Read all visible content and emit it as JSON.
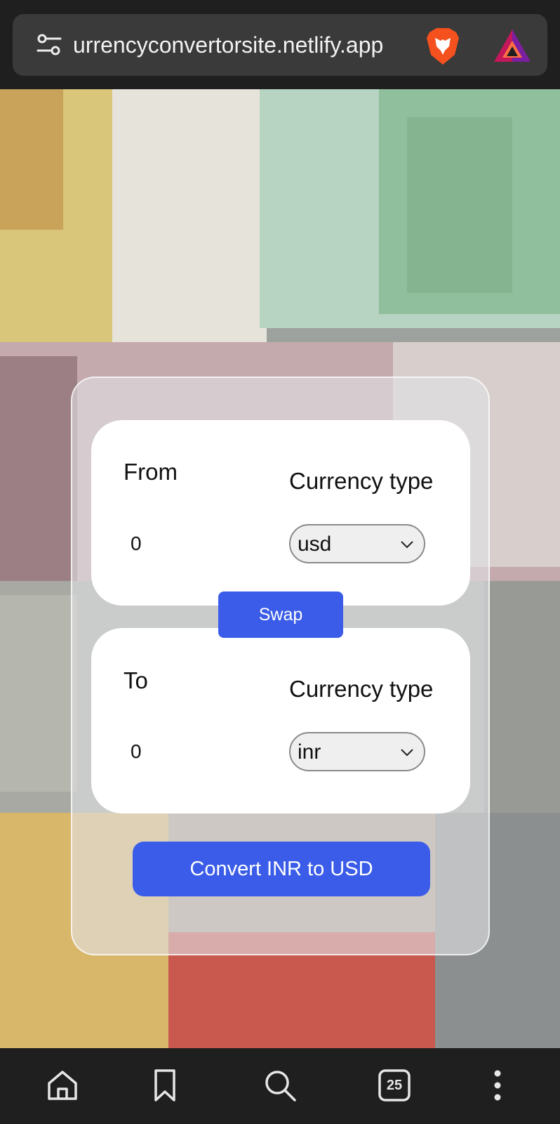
{
  "browser": {
    "url": "urrencyconvertorsite.netlify.app",
    "tab_count": "25"
  },
  "converter": {
    "from": {
      "label": "From",
      "type_label": "Currency type",
      "amount": "0",
      "currency": "usd"
    },
    "swap_label": "Swap",
    "to": {
      "label": "To",
      "type_label": "Currency type",
      "amount": "0",
      "currency": "inr"
    },
    "convert_label": "Convert INR to USD"
  },
  "colors": {
    "accent": "#3a5ce8",
    "browser_chrome": "#1f1f1f",
    "url_bar": "#3a3a3a"
  },
  "icons": [
    "tune-icon",
    "brave-lion-icon",
    "brave-rewards-icon",
    "home-icon",
    "bookmark-icon",
    "search-icon",
    "tabs-icon",
    "more-vertical-icon",
    "chevron-down-icon"
  ]
}
